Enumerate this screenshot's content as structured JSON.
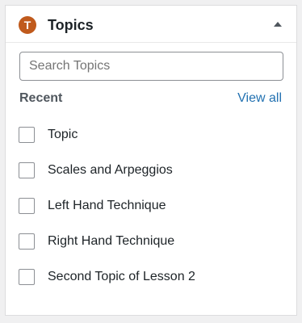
{
  "panel": {
    "icon_letter": "T",
    "title": "Topics",
    "collapse_icon": "triangle-up-icon"
  },
  "search": {
    "placeholder": "Search Topics",
    "value": ""
  },
  "recent": {
    "label": "Recent",
    "view_all_label": "View all"
  },
  "topics": [
    {
      "label": "Topic",
      "checked": false
    },
    {
      "label": "Scales and Arpeggios",
      "checked": false
    },
    {
      "label": "Left Hand Technique",
      "checked": false
    },
    {
      "label": "Right Hand Technique",
      "checked": false
    },
    {
      "label": "Second Topic of Lesson 2",
      "checked": false
    }
  ],
  "colors": {
    "brand": "#c05a1c",
    "link": "#2271b1",
    "border": "#8c8f94"
  }
}
